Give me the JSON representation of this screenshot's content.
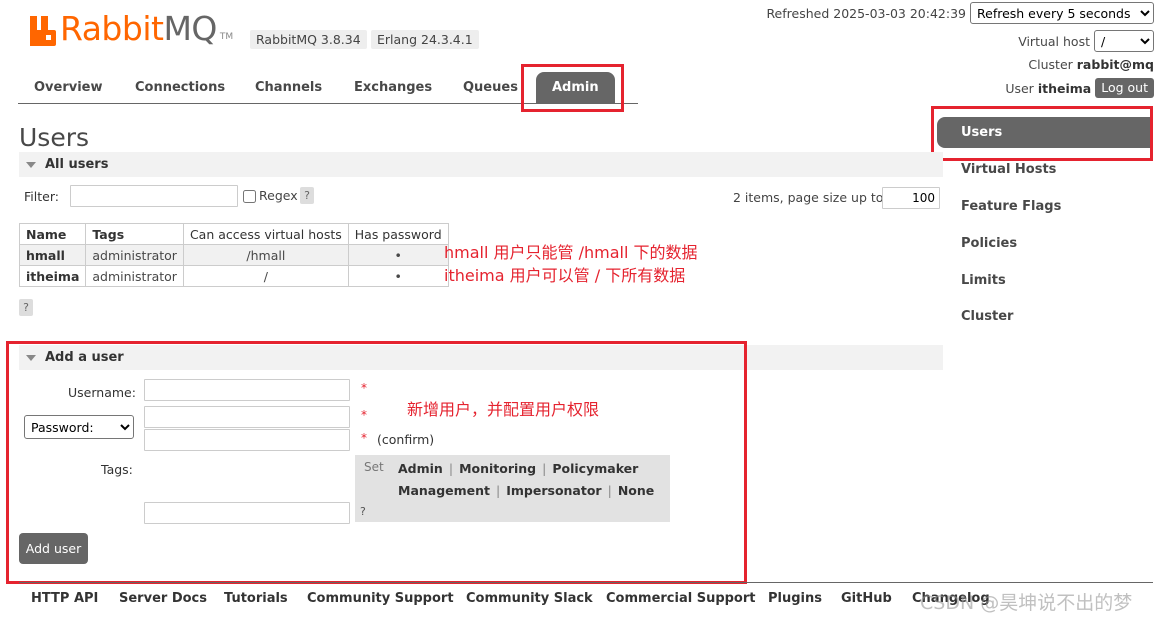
{
  "brand": {
    "rabbit": "Rabbit",
    "mq": "MQ",
    "tm": "TM",
    "color": "#ff6600"
  },
  "versions": {
    "rabbitmq": "RabbitMQ 3.8.34",
    "erlang": "Erlang 24.3.4.1"
  },
  "status": {
    "refreshed_label": "Refreshed 2025-03-03 20:42:39",
    "refresh_option": "Refresh every 5 seconds",
    "vhost_label": "Virtual host",
    "vhost_value": "/",
    "cluster_label": "Cluster",
    "cluster_value": "rabbit@mq",
    "user_label": "User",
    "user_value": "itheima",
    "logout": "Log out"
  },
  "tabs": [
    {
      "label": "Overview"
    },
    {
      "label": "Connections"
    },
    {
      "label": "Channels"
    },
    {
      "label": "Exchanges"
    },
    {
      "label": "Queues"
    },
    {
      "label": "Admin",
      "active": true
    }
  ],
  "right_nav": [
    {
      "label": "Users",
      "active": true
    },
    {
      "label": "Virtual Hosts"
    },
    {
      "label": "Feature Flags"
    },
    {
      "label": "Policies"
    },
    {
      "label": "Limits"
    },
    {
      "label": "Cluster"
    }
  ],
  "page": {
    "title": "Users",
    "all_users_section": "All users",
    "filter_label": "Filter:",
    "regex_label": "Regex",
    "help": "?",
    "pagination_text": "2 items, page size up to",
    "page_size": "100"
  },
  "users_table": {
    "headers": [
      "Name",
      "Tags",
      "Can access virtual hosts",
      "Has password"
    ],
    "rows": [
      {
        "name": "hmall",
        "tags": "administrator",
        "vhosts": "/hmall",
        "has_password": "•"
      },
      {
        "name": "itheima",
        "tags": "administrator",
        "vhosts": "/",
        "has_password": "•"
      }
    ]
  },
  "annotations": {
    "line1": "hmall 用户只能管 /hmall 下的数据",
    "line2": "itheima 用户可以管 / 下所有数据",
    "add_note": "新增用户，并配置用户权限",
    "color": "#e5232f"
  },
  "add_user": {
    "section": "Add a user",
    "username_label": "Username:",
    "password_option": "Password:",
    "required": "*",
    "confirm": "(confirm)",
    "tags_label": "Tags:",
    "set_label": "Set",
    "tags_row1": [
      "Admin",
      "Monitoring",
      "Policymaker"
    ],
    "tags_row2": [
      "Management",
      "Impersonator",
      "None"
    ],
    "separator": "|",
    "submit": "Add user"
  },
  "footer": {
    "links": [
      "HTTP API",
      "Server Docs",
      "Tutorials",
      "Community Support",
      "Community Slack",
      "Commercial Support",
      "Plugins",
      "GitHub",
      "Changelog"
    ],
    "watermark": "CSDN @昊坤说不出的梦"
  }
}
